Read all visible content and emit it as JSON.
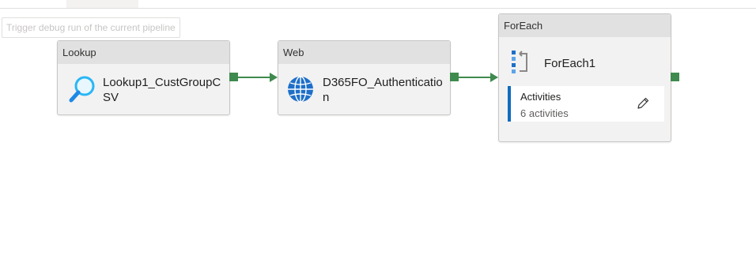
{
  "tooltip": {
    "text": "Trigger debug run of the current pipeline"
  },
  "activities": {
    "lookup": {
      "type": "Lookup",
      "name": "Lookup1_CustGroupCSV",
      "icon": "search-icon"
    },
    "web": {
      "type": "Web",
      "name": "D365FO_Authentication",
      "icon": "globe-icon"
    },
    "foreach": {
      "type": "ForEach",
      "name": "ForEach1",
      "icon": "foreach-icon",
      "inner": {
        "title": "Activities",
        "count": "6 activities",
        "edit_icon": "pencil-icon"
      }
    }
  },
  "colors": {
    "connector": "#3f8a4e",
    "accent": "#0f6cbd",
    "lookup_icon": "#29b6f6",
    "globe": "#1e6fc8"
  }
}
